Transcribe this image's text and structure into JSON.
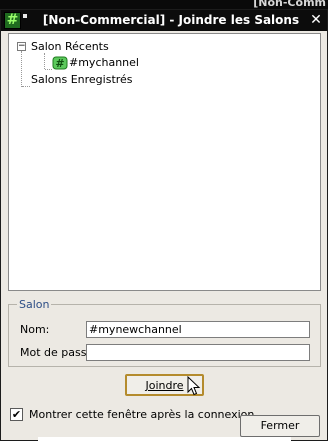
{
  "background": {
    "partial_title": "[Non-Comm"
  },
  "window": {
    "title": "[Non-Commercial] - Joindre les Salons",
    "app_icon_glyph": "#",
    "close_glyph": "✕"
  },
  "tree": {
    "root_recent": "Salon Récents",
    "recent_channel": "#mychannel",
    "root_saved": "Salons Enregistrés",
    "expander_glyph": "−"
  },
  "group": {
    "title": "Salon",
    "name_label": "Nom:",
    "name_value": "#mynewchannel",
    "password_label": "Mot de pass:",
    "password_value": ""
  },
  "buttons": {
    "join": "Joindre",
    "close": "Fermer"
  },
  "checkbox": {
    "label": "Montrer cette fenêtre après la connexion",
    "checked_glyph": "✔"
  },
  "colors": {
    "titlebar": "#0c0c0c",
    "window_bg": "#ece9e3",
    "group_title": "#2d4e86",
    "channel_icon": "#2ea82e"
  }
}
